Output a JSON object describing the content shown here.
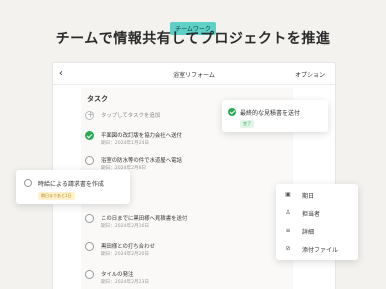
{
  "tagline": "チームワーク",
  "headline": "チームで情報共有してプロジェクトを推進",
  "header": {
    "back_icon": "chevron-left-icon",
    "title": "浴室リフォーム",
    "options_label": "オプション"
  },
  "section_title": "タスク",
  "tasks": [
    {
      "label": "タップしてタスクを追加",
      "due": "",
      "state": "add"
    },
    {
      "label": "平面図の改訂版を協力会社へ送付",
      "due": "期日：2024年1月24日",
      "state": "done"
    },
    {
      "label": "浴室の防水等の件で水道屋へ電話",
      "due": "期日：2024年2月8日",
      "state": "open"
    },
    {
      "label": "この日までに黒田様へ見積書を送付",
      "due": "期日：2024年2月16日",
      "state": "open"
    },
    {
      "label": "黒田様との打ち合わせ",
      "due": "期日：2024年2月20日",
      "state": "open"
    },
    {
      "label": "タイルの発注",
      "due": "期日：2024年2月23日",
      "state": "open"
    }
  ],
  "popover_done": {
    "label": "最終的な見積書を送付",
    "badge": "完了",
    "badge_color": "#e2f4e8",
    "badge_text_color": "#2aa853"
  },
  "popover_pending": {
    "label": "時給による請求書を作成",
    "badge": "期日まであと1日",
    "badge_color": "#fdf1cf",
    "badge_text_color": "#b78a12"
  },
  "menu": {
    "items": [
      {
        "label": "期日",
        "icon": "calendar-icon"
      },
      {
        "label": "担当者",
        "icon": "person-icon"
      },
      {
        "label": "詳細",
        "icon": "lines-icon"
      },
      {
        "label": "添付ファイル",
        "icon": "paperclip-icon"
      }
    ]
  },
  "colors": {
    "accent": "#5fd0c6",
    "done_green": "#2aa853",
    "background": "#f3f2ef"
  }
}
